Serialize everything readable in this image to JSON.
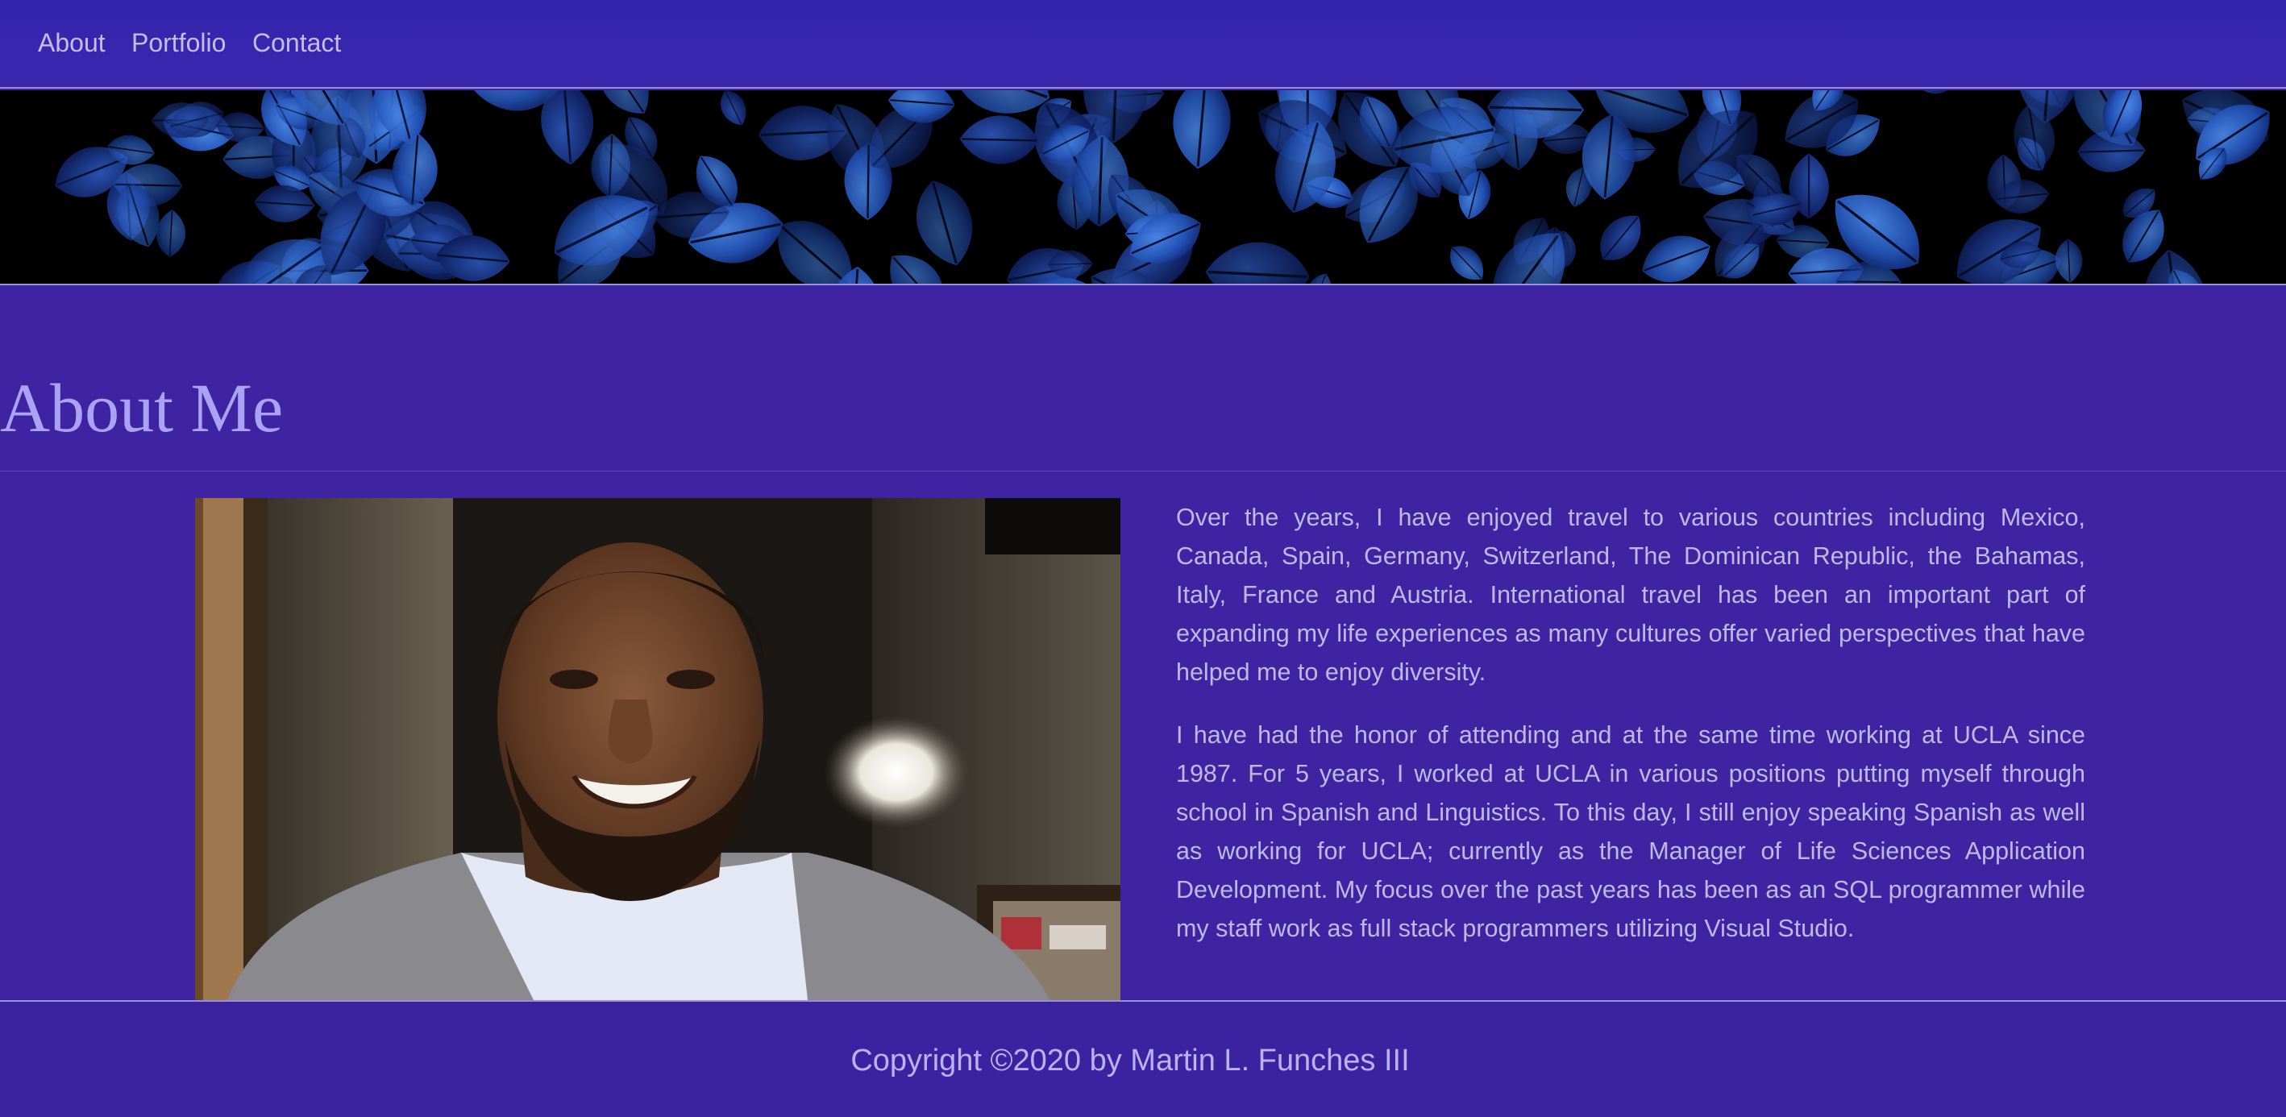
{
  "nav": {
    "items": [
      {
        "label": "About"
      },
      {
        "label": "Portfolio"
      },
      {
        "label": "Contact"
      }
    ]
  },
  "banner": {
    "image": "dark-blue-leaves-banner"
  },
  "about": {
    "title": "About Me",
    "portrait_image": "smiling-man-portrait-photo",
    "paragraphs": [
      "Over the years, I have enjoyed travel to various countries including Mexico, Canada, Spain, Germany, Switzerland, The Dominican Republic, the Bahamas, Italy, France and Austria. International travel has been an important part of expanding my life experiences as many cultures offer varied perspectives that have helped me to enjoy diversity.",
      "I have had the honor of attending and at the same time working at UCLA since 1987. For 5 years, I worked at UCLA in various positions putting myself through school in Spanish and Linguistics. To this day, I still enjoy speaking Spanish as well as working for UCLA; currently as the Manager of Life Sciences Application Development. My focus over the past years has been as an SQL programmer while my staff work as full stack programmers utilizing Visual Studio."
    ]
  },
  "footer": {
    "copyright": "Copyright ©2020 by Martin L. Funches III"
  },
  "colors": {
    "background": "#3e24a2",
    "nav_background": "#3524ad",
    "title": "#a9a2f5",
    "body_text": "#bfb8e6",
    "divider": "#9b8fd6"
  }
}
